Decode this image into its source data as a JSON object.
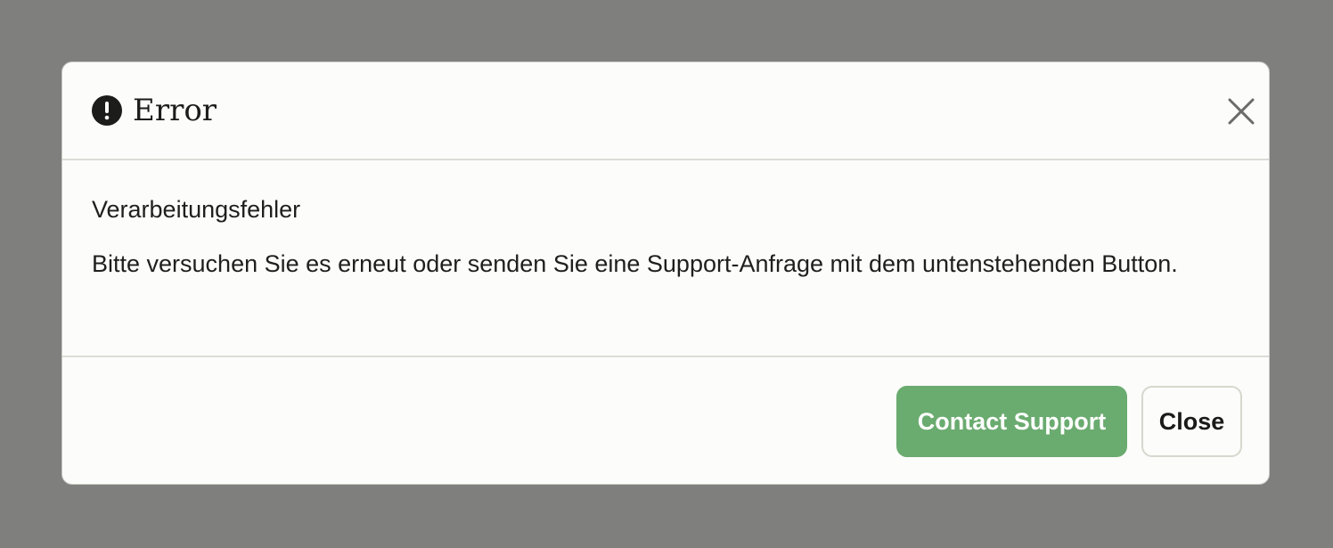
{
  "dialog": {
    "title": "Error",
    "icon": "alert-circle-icon",
    "close_icon": "close-icon",
    "heading": "Verarbeitungsfehler",
    "message": "Bitte versuchen Sie es erneut oder senden Sie eine Support-Anfrage mit dem untenstehenden Button.",
    "buttons": {
      "contact_support": "Contact Support",
      "close": "Close"
    }
  },
  "colors": {
    "overlay": "#7f7f7d",
    "dialog_background": "#fcfcfa",
    "primary_button": "#6aab6f",
    "divider": "#dcdcd7",
    "text": "#1f1f1d"
  }
}
